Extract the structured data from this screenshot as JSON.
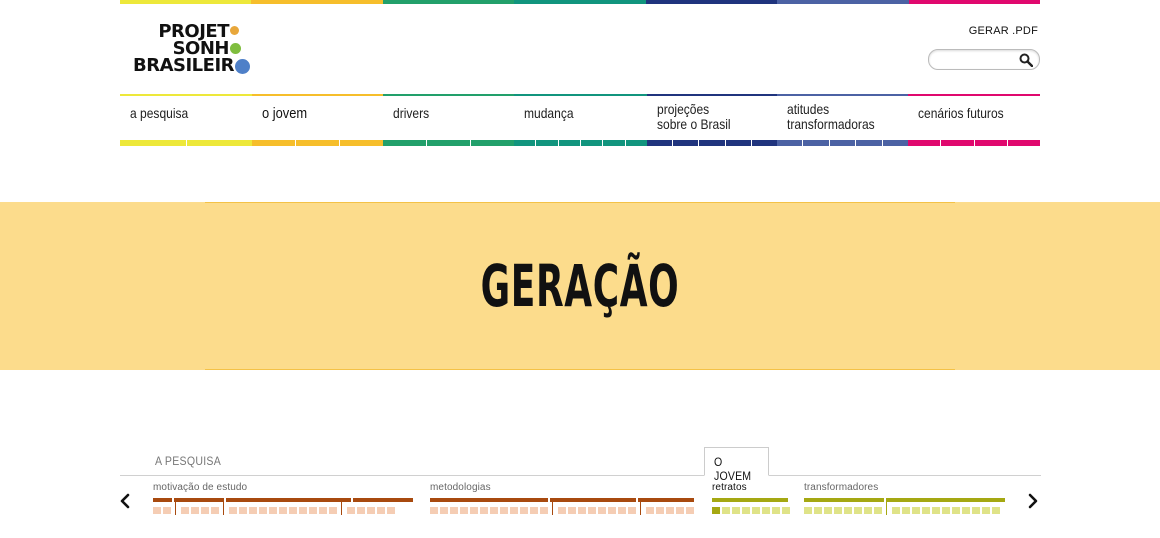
{
  "colors": {
    "yellow": "#ede83a",
    "orange": "#f6be2b",
    "green": "#22a06b",
    "teal": "#11957e",
    "navy": "#20347e",
    "slate": "#4c62a4",
    "magenta": "#e0086e",
    "banner_bg": "#fcdc8c",
    "brown": "#a84a0f",
    "peach": "#f5cdb4",
    "olive": "#a5a812",
    "lime_light": "#dfe388"
  },
  "logo": {
    "line1": "PROJET",
    "line2": "SONH",
    "line3": "BRASILEIR",
    "dot1_color": "#e8a73b",
    "dot2_color": "#7fbd3e",
    "dot3_color": "#4f80c8"
  },
  "header": {
    "pdf_label": "GERAR .PDF",
    "search_placeholder": "",
    "search_icon": "search-icon"
  },
  "nav": [
    {
      "label": "a pesquisa",
      "color": "#ede83a",
      "segments": 2,
      "active": false
    },
    {
      "label": "o jovem",
      "color": "#f6be2b",
      "segments": 3,
      "active": true
    },
    {
      "label": "drivers",
      "color": "#22a06b",
      "segments": 3,
      "active": false
    },
    {
      "label": "mudança",
      "color": "#11957e",
      "segments": 6,
      "active": false
    },
    {
      "label": "projeções\nsobre o Brasil",
      "color": "#20347e",
      "segments": 5,
      "active": false
    },
    {
      "label": "atitudes\ntransformadoras",
      "color": "#4c62a4",
      "segments": 5,
      "active": false
    },
    {
      "label": "cenários futuros",
      "color": "#e0086e",
      "segments": 4,
      "active": false
    }
  ],
  "banner": {
    "title": "GERAÇÃO"
  },
  "subnav": {
    "tab_pesquisa": "A PESQUISA",
    "tab_jovem": "O JOVEM",
    "prev_icon": "chevron-left-icon",
    "next_icon": "chevron-right-icon",
    "groups": [
      {
        "label": "motivação de estudo",
        "bar_color": "#a84a0f",
        "square_color": "#f5cdb4",
        "clusters": [
          2,
          4,
          11,
          5
        ],
        "active_index": -1
      },
      {
        "label": "metodologias",
        "bar_color": "#a84a0f",
        "square_color": "#f5cdb4",
        "clusters": [
          12,
          8,
          5
        ],
        "active_index": -1
      },
      {
        "label": "retratos",
        "bar_color": "#a5a812",
        "square_color": "#dfe388",
        "clusters": [
          8
        ],
        "active_index": 0
      },
      {
        "label": "transformadores",
        "bar_color": "#a5a812",
        "square_color": "#dfe388",
        "clusters": [
          8,
          11
        ],
        "active_index": -1
      }
    ]
  }
}
